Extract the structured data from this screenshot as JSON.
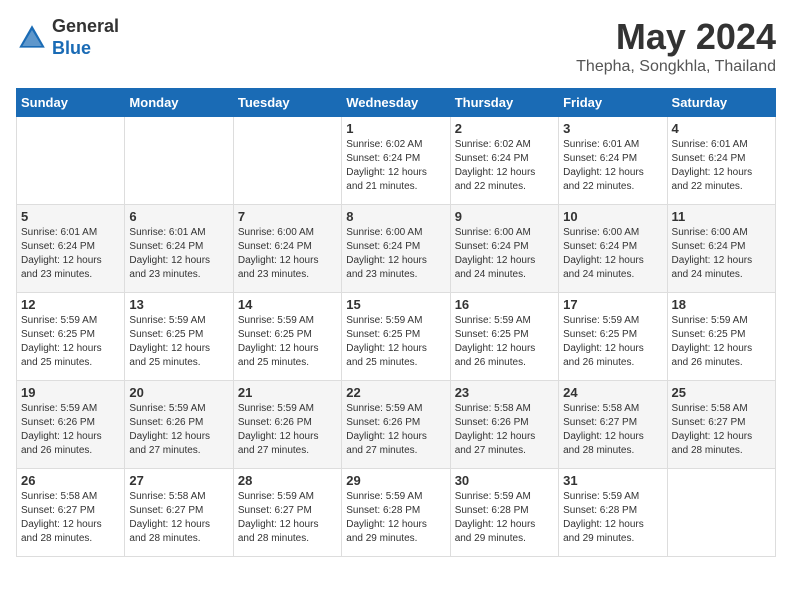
{
  "logo": {
    "general": "General",
    "blue": "Blue"
  },
  "title": "May 2024",
  "subtitle": "Thepha, Songkhla, Thailand",
  "days_of_week": [
    "Sunday",
    "Monday",
    "Tuesday",
    "Wednesday",
    "Thursday",
    "Friday",
    "Saturday"
  ],
  "weeks": [
    [
      {
        "day": "",
        "info": ""
      },
      {
        "day": "",
        "info": ""
      },
      {
        "day": "",
        "info": ""
      },
      {
        "day": "1",
        "info": "Sunrise: 6:02 AM\nSunset: 6:24 PM\nDaylight: 12 hours and 21 minutes."
      },
      {
        "day": "2",
        "info": "Sunrise: 6:02 AM\nSunset: 6:24 PM\nDaylight: 12 hours and 22 minutes."
      },
      {
        "day": "3",
        "info": "Sunrise: 6:01 AM\nSunset: 6:24 PM\nDaylight: 12 hours and 22 minutes."
      },
      {
        "day": "4",
        "info": "Sunrise: 6:01 AM\nSunset: 6:24 PM\nDaylight: 12 hours and 22 minutes."
      }
    ],
    [
      {
        "day": "5",
        "info": "Sunrise: 6:01 AM\nSunset: 6:24 PM\nDaylight: 12 hours and 23 minutes."
      },
      {
        "day": "6",
        "info": "Sunrise: 6:01 AM\nSunset: 6:24 PM\nDaylight: 12 hours and 23 minutes."
      },
      {
        "day": "7",
        "info": "Sunrise: 6:00 AM\nSunset: 6:24 PM\nDaylight: 12 hours and 23 minutes."
      },
      {
        "day": "8",
        "info": "Sunrise: 6:00 AM\nSunset: 6:24 PM\nDaylight: 12 hours and 23 minutes."
      },
      {
        "day": "9",
        "info": "Sunrise: 6:00 AM\nSunset: 6:24 PM\nDaylight: 12 hours and 24 minutes."
      },
      {
        "day": "10",
        "info": "Sunrise: 6:00 AM\nSunset: 6:24 PM\nDaylight: 12 hours and 24 minutes."
      },
      {
        "day": "11",
        "info": "Sunrise: 6:00 AM\nSunset: 6:24 PM\nDaylight: 12 hours and 24 minutes."
      }
    ],
    [
      {
        "day": "12",
        "info": "Sunrise: 5:59 AM\nSunset: 6:25 PM\nDaylight: 12 hours and 25 minutes."
      },
      {
        "day": "13",
        "info": "Sunrise: 5:59 AM\nSunset: 6:25 PM\nDaylight: 12 hours and 25 minutes."
      },
      {
        "day": "14",
        "info": "Sunrise: 5:59 AM\nSunset: 6:25 PM\nDaylight: 12 hours and 25 minutes."
      },
      {
        "day": "15",
        "info": "Sunrise: 5:59 AM\nSunset: 6:25 PM\nDaylight: 12 hours and 25 minutes."
      },
      {
        "day": "16",
        "info": "Sunrise: 5:59 AM\nSunset: 6:25 PM\nDaylight: 12 hours and 26 minutes."
      },
      {
        "day": "17",
        "info": "Sunrise: 5:59 AM\nSunset: 6:25 PM\nDaylight: 12 hours and 26 minutes."
      },
      {
        "day": "18",
        "info": "Sunrise: 5:59 AM\nSunset: 6:25 PM\nDaylight: 12 hours and 26 minutes."
      }
    ],
    [
      {
        "day": "19",
        "info": "Sunrise: 5:59 AM\nSunset: 6:26 PM\nDaylight: 12 hours and 26 minutes."
      },
      {
        "day": "20",
        "info": "Sunrise: 5:59 AM\nSunset: 6:26 PM\nDaylight: 12 hours and 27 minutes."
      },
      {
        "day": "21",
        "info": "Sunrise: 5:59 AM\nSunset: 6:26 PM\nDaylight: 12 hours and 27 minutes."
      },
      {
        "day": "22",
        "info": "Sunrise: 5:59 AM\nSunset: 6:26 PM\nDaylight: 12 hours and 27 minutes."
      },
      {
        "day": "23",
        "info": "Sunrise: 5:58 AM\nSunset: 6:26 PM\nDaylight: 12 hours and 27 minutes."
      },
      {
        "day": "24",
        "info": "Sunrise: 5:58 AM\nSunset: 6:27 PM\nDaylight: 12 hours and 28 minutes."
      },
      {
        "day": "25",
        "info": "Sunrise: 5:58 AM\nSunset: 6:27 PM\nDaylight: 12 hours and 28 minutes."
      }
    ],
    [
      {
        "day": "26",
        "info": "Sunrise: 5:58 AM\nSunset: 6:27 PM\nDaylight: 12 hours and 28 minutes."
      },
      {
        "day": "27",
        "info": "Sunrise: 5:58 AM\nSunset: 6:27 PM\nDaylight: 12 hours and 28 minutes."
      },
      {
        "day": "28",
        "info": "Sunrise: 5:59 AM\nSunset: 6:27 PM\nDaylight: 12 hours and 28 minutes."
      },
      {
        "day": "29",
        "info": "Sunrise: 5:59 AM\nSunset: 6:28 PM\nDaylight: 12 hours and 29 minutes."
      },
      {
        "day": "30",
        "info": "Sunrise: 5:59 AM\nSunset: 6:28 PM\nDaylight: 12 hours and 29 minutes."
      },
      {
        "day": "31",
        "info": "Sunrise: 5:59 AM\nSunset: 6:28 PM\nDaylight: 12 hours and 29 minutes."
      },
      {
        "day": "",
        "info": ""
      }
    ]
  ]
}
